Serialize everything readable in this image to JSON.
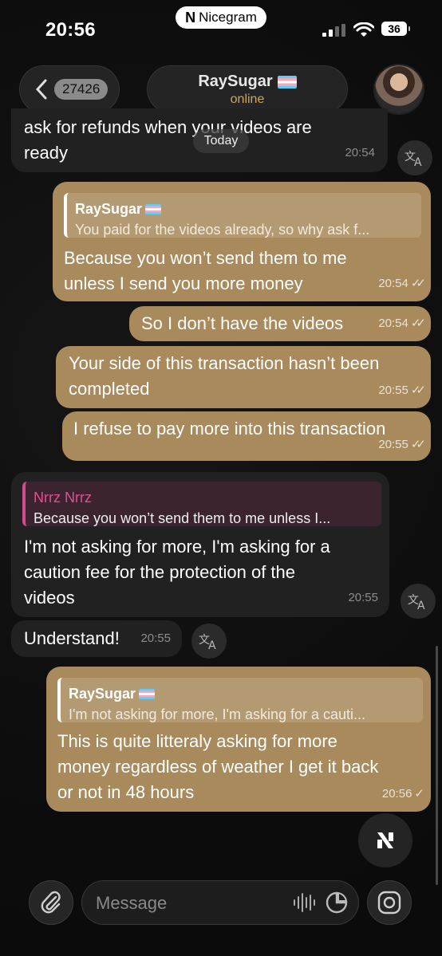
{
  "status_bar": {
    "time": "20:56",
    "app_badge": "Nicegram",
    "battery": "36"
  },
  "header": {
    "back_count": "27426",
    "contact_name": "RaySugar",
    "contact_status": "online"
  },
  "date_separator": "Today",
  "messages": [
    {
      "dir": "in",
      "text_lines": [
        "ask for refunds when your videos are",
        "ready"
      ],
      "time": "20:54"
    },
    {
      "dir": "out",
      "reply_name": "RaySugar",
      "reply_text": "You paid for the videos already, so why ask f...",
      "text_lines": [
        "Because you won’t send them to me",
        "unless I send you more money"
      ],
      "time": "20:54"
    },
    {
      "dir": "out",
      "text": "So I don’t have the videos",
      "time": "20:54"
    },
    {
      "dir": "out",
      "text_lines": [
        "Your side of this transaction hasn’t been",
        "completed"
      ],
      "time": "20:55"
    },
    {
      "dir": "out",
      "text": "I refuse to pay more into this transaction",
      "time": "20:55"
    },
    {
      "dir": "in",
      "reply_name": "Nrrz Nrrz",
      "reply_text": "Because you won’t send them to me unless I...",
      "text_lines": [
        "I'm not asking for more, I'm asking for a",
        "caution fee for the protection of the",
        "videos"
      ],
      "time": "20:55"
    },
    {
      "dir": "in",
      "text": "Understand!",
      "time": "20:55"
    },
    {
      "dir": "out",
      "reply_name": "RaySugar",
      "reply_text": "I'm not asking for more, I'm asking for a cauti...",
      "text_lines": [
        "This is quite litteraly asking for more",
        "money regardless of weather I get it back",
        "or not in 48 hours"
      ],
      "time": "20:56"
    }
  ],
  "input": {
    "placeholder": "Message"
  },
  "colors": {
    "outgoing_bubble": "#a88a5c",
    "incoming_bubble": "#212121",
    "reply_accent_in": "#d44b8e",
    "status_online": "#c9a56a"
  },
  "icons": [
    "back-chevron-icon",
    "translate-icon",
    "nicegram-logo-icon",
    "attach-icon",
    "waveform-icon",
    "sticker-icon",
    "camera-icon"
  ]
}
